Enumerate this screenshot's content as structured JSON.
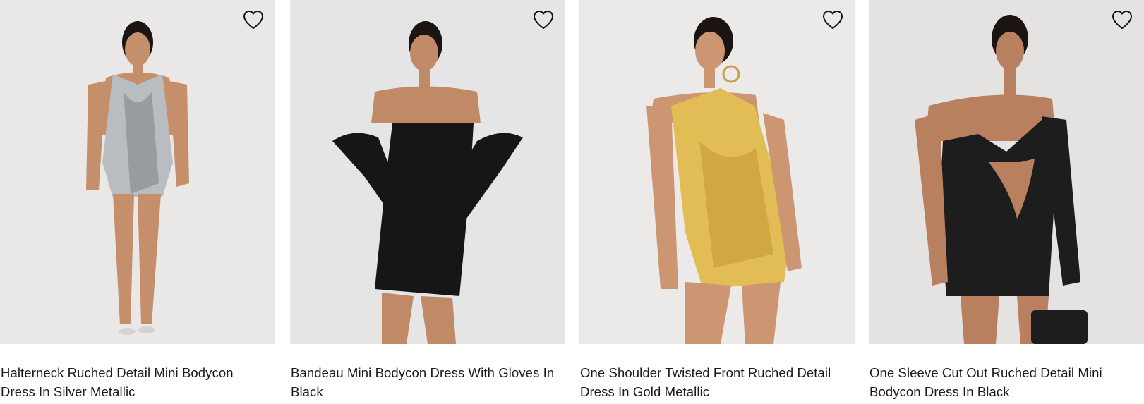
{
  "products": [
    {
      "title": "Halterneck Ruched Detail Mini Bodycon Dress In Silver Metallic",
      "image_alt": "model in silver metallic halterneck mini dress",
      "wishlist_icon": "heart-outline-icon",
      "colors": {
        "background": "#e9e8e6",
        "dress": "#b9bcc0",
        "dress_shade": "#7d8187",
        "skin": "#c58f6c",
        "hair": "#1b1412"
      }
    },
    {
      "title": "Bandeau Mini Bodycon Dress With Gloves In Black",
      "image_alt": "model in black bandeau mini dress with long gloves",
      "wishlist_icon": "heart-outline-icon",
      "colors": {
        "background": "#e6e5e5",
        "dress": "#161616",
        "dress_shade": "#2a2a2a",
        "skin": "#c08a66",
        "hair": "#1b1412"
      }
    },
    {
      "title": "One Shoulder Twisted Front Ruched Detail Dress In Gold Metallic",
      "image_alt": "model in gold metallic one shoulder mini dress",
      "wishlist_icon": "heart-outline-icon",
      "colors": {
        "background": "#ebeae9",
        "dress": "#e2bd55",
        "dress_shade": "#b88d2a",
        "skin": "#cc9673",
        "hair": "#1b1412"
      }
    },
    {
      "title": "One Sleeve Cut Out Ruched Detail Mini Bodycon Dress In Black",
      "image_alt": "model in black one sleeve cut out mini dress",
      "wishlist_icon": "heart-outline-icon",
      "colors": {
        "background": "#e4e3e2",
        "dress": "#1d1d1e",
        "dress_shade": "#3a3a3c",
        "skin": "#b98060",
        "hair": "#1b1412"
      }
    }
  ]
}
